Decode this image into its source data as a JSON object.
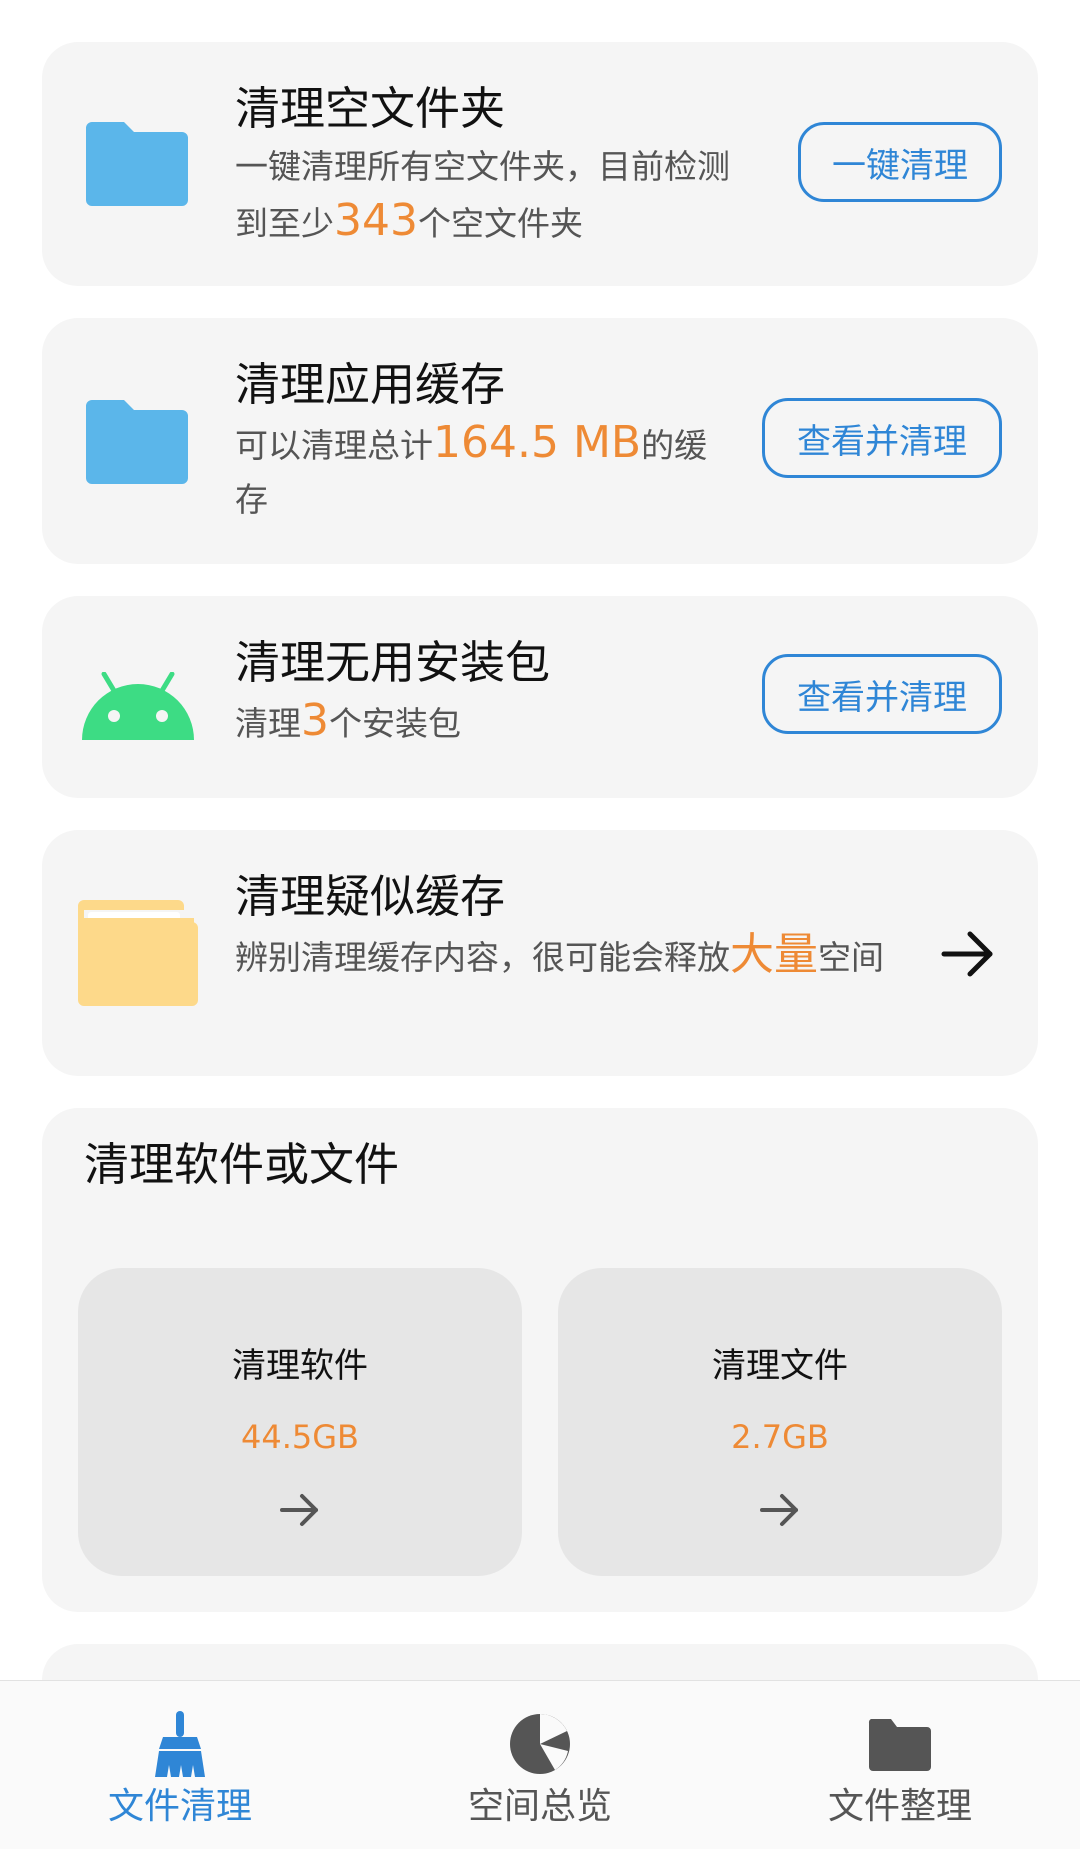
{
  "cards": {
    "empty_folders": {
      "title": "清理空文件夹",
      "desc_before": "一键清理所有空文件夹，目前检测到至少",
      "count": "343",
      "desc_after": "个空文件夹",
      "button": "一键清理"
    },
    "app_cache": {
      "title": "清理应用缓存",
      "desc_before": "可以清理总计",
      "size": "164.5 MB",
      "desc_after": "的缓存",
      "button": "查看并清理"
    },
    "apk": {
      "title": "清理无用安装包",
      "desc_before": "清理",
      "count": "3",
      "desc_after": "个安装包",
      "button": "查看并清理"
    },
    "suspected_cache": {
      "title": "清理疑似缓存",
      "desc_before": "辨别清理缓存内容，很可能会释放",
      "highlight": "大量",
      "desc_after": "空间"
    }
  },
  "clean_section": {
    "title": "清理软件或文件",
    "tiles": [
      {
        "label": "清理软件",
        "value": "44.5GB"
      },
      {
        "label": "清理文件",
        "value": "2.7GB"
      }
    ]
  },
  "bottom_nav": {
    "items": [
      {
        "label": "文件清理",
        "icon": "broom-icon",
        "active": true
      },
      {
        "label": "空间总览",
        "icon": "pie-chart-icon",
        "active": false
      },
      {
        "label": "文件整理",
        "icon": "folder-icon",
        "active": false
      }
    ]
  },
  "colors": {
    "accent_blue": "#2f86d6",
    "highlight_orange": "#ee8a35",
    "card_bg": "#f5f5f5",
    "tile_bg": "#e6e6e6",
    "folder_blue": "#5bb6ea",
    "android_green": "#3ddc84",
    "folder_yellow": "#fdd98a"
  }
}
